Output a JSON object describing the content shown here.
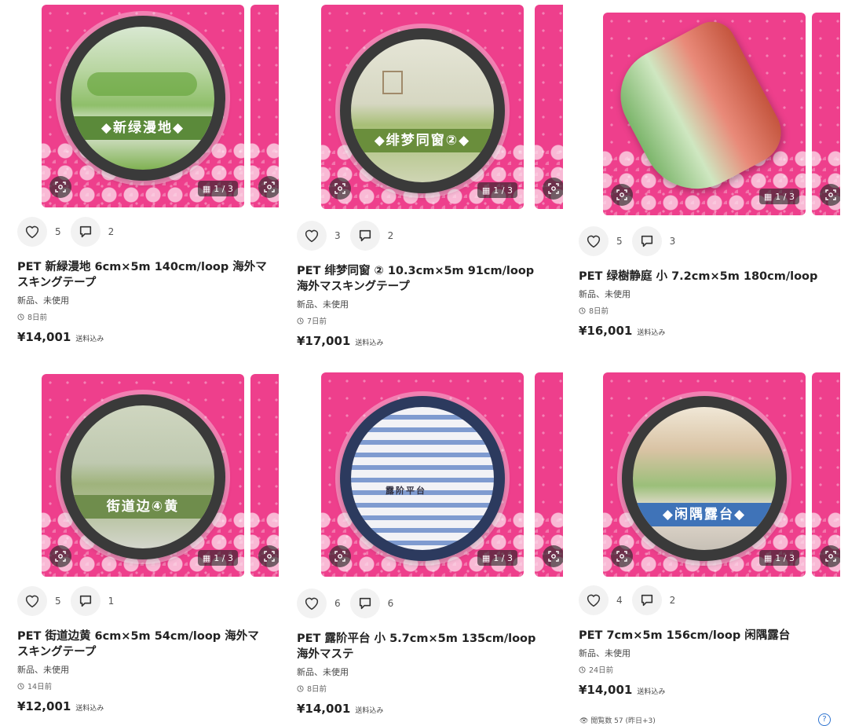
{
  "items": [
    {
      "tape_label": "◆新绿漫地◆",
      "image_counter": "1 / 3",
      "likes": "5",
      "comments": "2",
      "title": "PET 新緑漫地 6cm×5m 140cm/loop 海外マスキングテープ",
      "condition": "新品、未使用",
      "posted": "8日前",
      "price": "¥14,001",
      "shipping": "送料込み"
    },
    {
      "tape_label": "◆绯梦同窗②◆",
      "image_counter": "1 / 3",
      "likes": "3",
      "comments": "2",
      "title": "PET 绯梦同窗 ② 10.3cm×5m 91cm/loop 海外マスキングテープ",
      "condition": "新品、未使用",
      "posted": "7日前",
      "price": "¥17,001",
      "shipping": "送料込み"
    },
    {
      "tape_label": "",
      "image_counter": "1 / 3",
      "likes": "5",
      "comments": "3",
      "title": "PET 绿樹静庭 小 7.2cm×5m 180cm/loop",
      "condition": "新品、未使用",
      "posted": "8日前",
      "price": "¥16,001",
      "shipping": "送料込み"
    },
    {
      "tape_label": "街道边④黄",
      "image_counter": "1 / 3",
      "likes": "5",
      "comments": "1",
      "title": "PET 街道边黄 6cm×5m 54cm/loop 海外マスキングテープ",
      "condition": "新品、未使用",
      "posted": "14日前",
      "price": "¥12,001",
      "shipping": "送料込み"
    },
    {
      "tape_label": "露阶平台",
      "image_counter": "1 / 3",
      "likes": "6",
      "comments": "6",
      "title": "PET 露阶平台 小 5.7cm×5m 135cm/loop 海外マステ",
      "condition": "新品、未使用",
      "posted": "8日前",
      "price": "¥14,001",
      "shipping": "送料込み"
    },
    {
      "tape_label": "◆闲隅露台◆",
      "image_counter": "1 / 3",
      "likes": "4",
      "comments": "2",
      "title": "PET 7cm×5m 156cm/loop 闲隅露台",
      "condition": "新品、未使用",
      "posted": "24日前",
      "price": "¥14,001",
      "shipping": "送料込み"
    }
  ],
  "footer": {
    "views": "閲覧数 57 (昨日+3)",
    "help": "?"
  },
  "colors": {
    "image_background": "#ee3f8c",
    "tape_label_green": "#5b8a3a",
    "tape_label_blue": "#3f73b8"
  }
}
